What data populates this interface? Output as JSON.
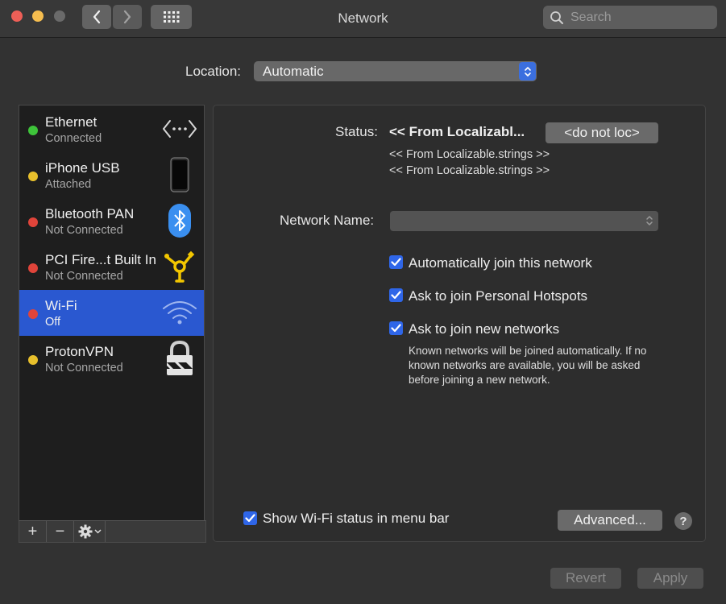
{
  "window": {
    "title": "Network"
  },
  "search": {
    "placeholder": "Search"
  },
  "location": {
    "label": "Location:",
    "value": "Automatic"
  },
  "services": [
    {
      "name": "Ethernet",
      "status": "Connected",
      "dot_color": "#3ec43a",
      "icon": "ethernet-icon"
    },
    {
      "name": "iPhone USB",
      "status": "Attached",
      "dot_color": "#e8c02c",
      "icon": "iphone-icon"
    },
    {
      "name": "Bluetooth PAN",
      "status": "Not Connected",
      "dot_color": "#e0443a",
      "icon": "bluetooth-icon"
    },
    {
      "name": "PCI Fire...t Built In",
      "status": "Not Connected",
      "dot_color": "#e0443a",
      "icon": "firewire-icon"
    },
    {
      "name": "Wi-Fi",
      "status": "Off",
      "dot_color": "#e0443a",
      "icon": "wifi-icon",
      "selected": true
    },
    {
      "name": "ProtonVPN",
      "status": "Not Connected",
      "dot_color": "#e8c02c",
      "icon": "vpn-lock-icon"
    }
  ],
  "sidebar_toolbar": {
    "add": "+",
    "remove": "−"
  },
  "status": {
    "label": "Status:",
    "value": "<< From Localizabl...",
    "button": "<do not loc>",
    "detail_1": "<< From Localizable.strings >>",
    "detail_2": "<< From Localizable.strings >>"
  },
  "network_name": {
    "label": "Network Name:",
    "value": ""
  },
  "options": {
    "auto_join": {
      "label": "Automatically join this network",
      "checked": true
    },
    "personal_hotspots": {
      "label": "Ask to join Personal Hotspots",
      "checked": true
    },
    "new_networks": {
      "label": "Ask to join new networks",
      "checked": true
    },
    "help_text": "Known networks will be joined automatically. If no known networks are available, you will be asked before joining a new network."
  },
  "menu_bar": {
    "label": "Show Wi-Fi status in menu bar",
    "checked": true
  },
  "buttons": {
    "advanced": "Advanced...",
    "help": "?",
    "revert": "Revert",
    "apply": "Apply"
  },
  "colors": {
    "accent": "#2f66e8",
    "selection": "#2a58d0"
  }
}
